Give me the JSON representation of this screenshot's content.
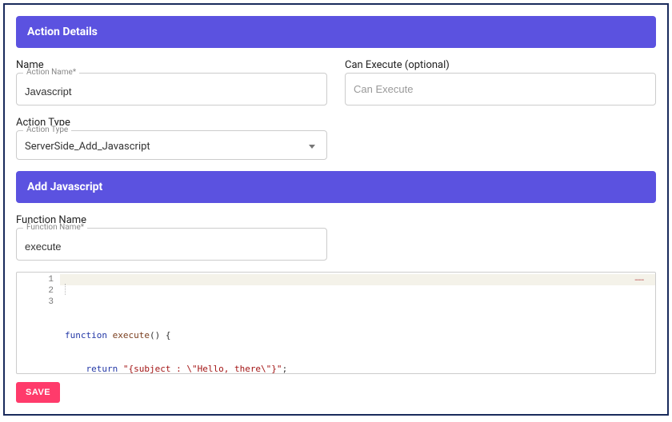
{
  "sections": {
    "action_details": {
      "title": "Action Details"
    },
    "add_javascript": {
      "title": "Add Javascript"
    }
  },
  "fields": {
    "name": {
      "label": "Name",
      "float_label": "Action Name*",
      "value": "Javascript"
    },
    "can_execute": {
      "label": "Can Execute (optional)",
      "placeholder": "Can Execute",
      "value": ""
    },
    "action_type": {
      "label": "Action Type",
      "float_label": "Action Type",
      "value": "ServerSide_Add_Javascript"
    },
    "function_name": {
      "label": "Function Name",
      "float_label": "Function Name*",
      "value": "execute"
    }
  },
  "code": {
    "lines": [
      "1",
      "2",
      "3"
    ],
    "l1": {
      "kw": "function",
      "fn": " execute",
      "rest": "() {"
    },
    "l2": {
      "kw": "return",
      "str": " \"{subject : \\\"Hello, there\\\"}\"",
      "rest": ";"
    },
    "l3": {
      "rest": "}"
    }
  },
  "buttons": {
    "save": "SAVE"
  }
}
